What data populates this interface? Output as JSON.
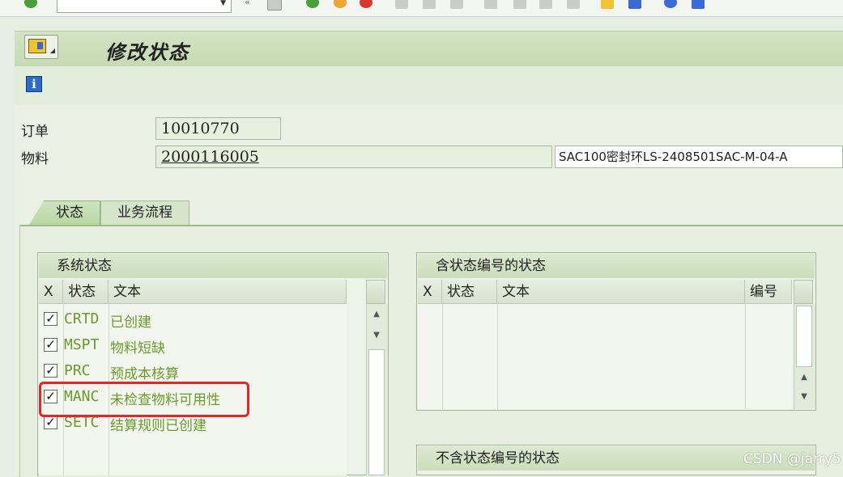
{
  "toolbar": {
    "command_field_value": ""
  },
  "header": {
    "title": "修改状态"
  },
  "form": {
    "order": {
      "label": "订单",
      "value": "10010770"
    },
    "material": {
      "label": "物料",
      "value": "2000116005",
      "description": "SAC100密封环LS-2408501SAC-M-04-A"
    }
  },
  "tabs": [
    {
      "label": "状态",
      "active": true
    },
    {
      "label": "业务流程",
      "active": false
    }
  ],
  "system_status": {
    "title": "系统状态",
    "columns": [
      "X",
      "状态",
      "文本"
    ],
    "rows": [
      {
        "checked": true,
        "code": "CRTD",
        "text": "已创建"
      },
      {
        "checked": true,
        "code": "MSPT",
        "text": "物料短缺"
      },
      {
        "checked": true,
        "code": "PRC",
        "text": "预成本核算"
      },
      {
        "checked": true,
        "code": "MANC",
        "text": "未检查物料可用性"
      },
      {
        "checked": true,
        "code": "SETC",
        "text": "结算规则已创建"
      }
    ]
  },
  "user_status_numbered": {
    "title": "含状态编号的状态",
    "columns": [
      "X",
      "状态",
      "文本",
      "编号"
    ]
  },
  "user_status_unnumbered": {
    "title": "不含状态编号的状态"
  },
  "watermark": "CSDN @jarry5",
  "colors": {
    "status_text": "#6a9a2c",
    "highlight": "#e3262b"
  }
}
